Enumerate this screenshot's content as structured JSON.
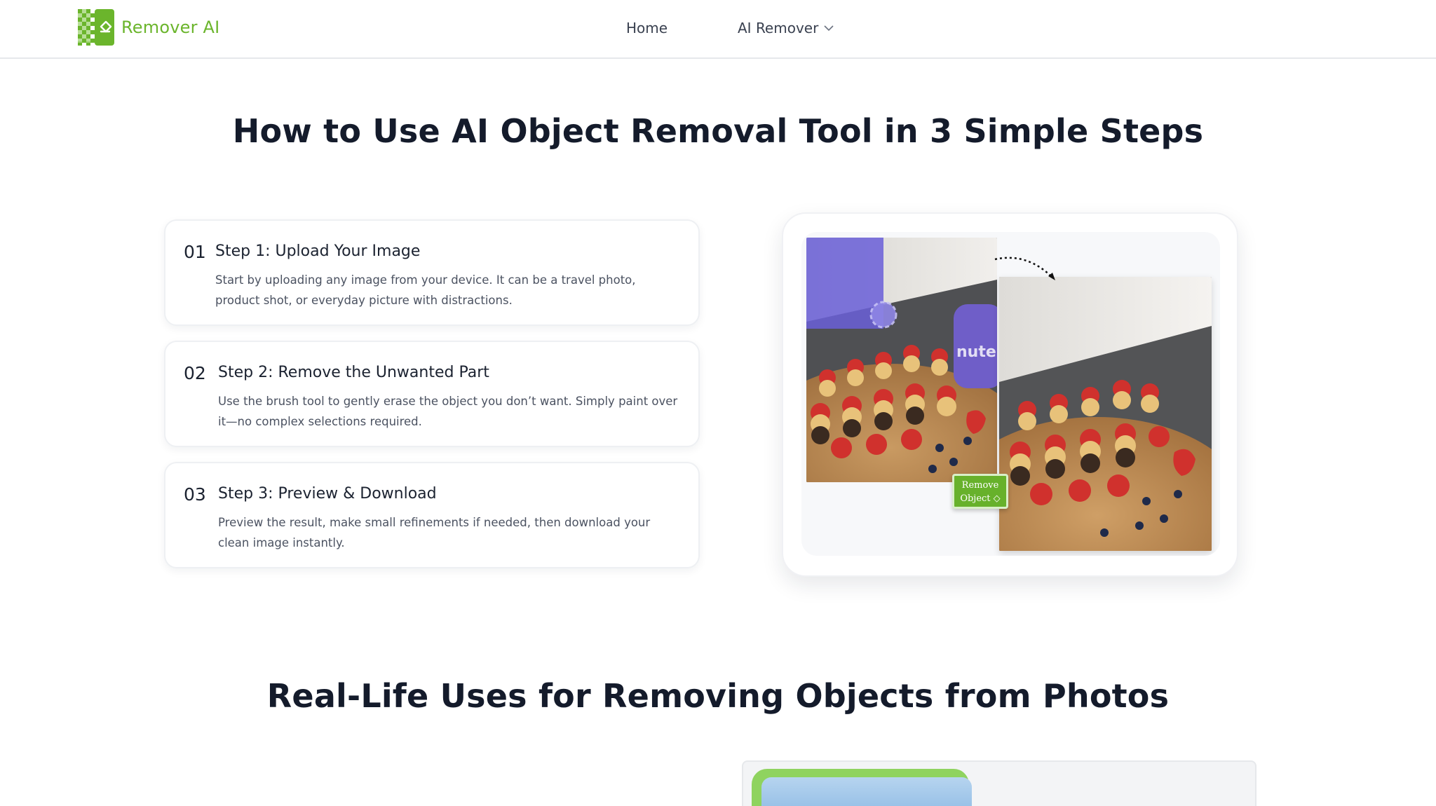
{
  "header": {
    "brand": "Remover AI",
    "nav": {
      "home": "Home",
      "ai_remover": "AI Remover"
    }
  },
  "steps_section": {
    "title": "How to Use AI Object Removal Tool in 3 Simple Steps",
    "steps": [
      {
        "num": "01",
        "title": "Step 1: Upload Your Image",
        "desc": "Start by uploading any image from your device. It can be a travel photo, product shot, or everyday picture with distractions."
      },
      {
        "num": "02",
        "title": "Step 2: Remove the Unwanted Part",
        "desc": "Use the brush tool to gently erase the object you don’t want. Simply paint over it—no complex selections required."
      },
      {
        "num": "03",
        "title": "Step 3: Preview & Download",
        "desc": "Preview the result, make small refinements if needed, then download your clean image instantly."
      }
    ],
    "demo": {
      "badge_line1": "Remove",
      "badge_line2": "Object",
      "jar_label": "nutella"
    }
  },
  "uses_section": {
    "title": "Real-Life Uses for Removing Objects from Photos"
  },
  "colors": {
    "brand_green": "#6bb52c",
    "heading": "#141b2b",
    "body_text": "#4b5261"
  }
}
